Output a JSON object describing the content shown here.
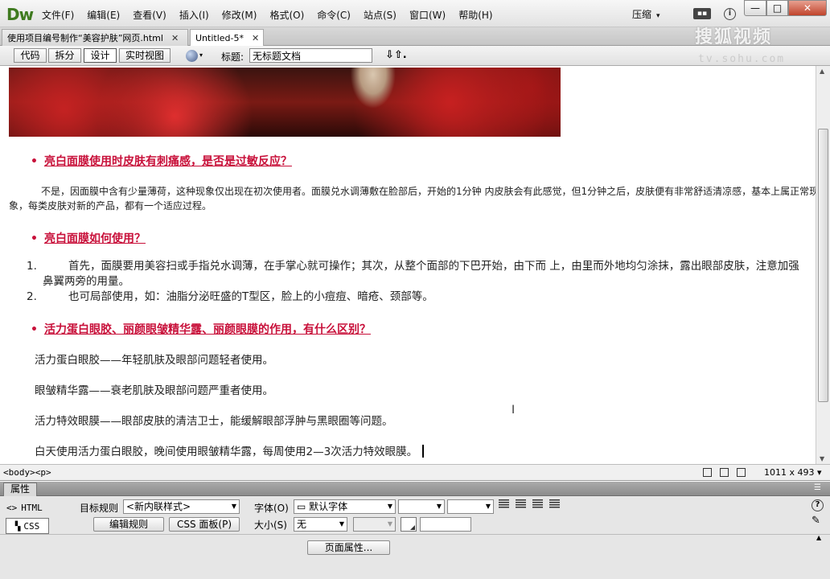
{
  "app": {
    "logo": "Dw",
    "workspace": "压缩"
  },
  "menu": [
    "文件(F)",
    "编辑(E)",
    "查看(V)",
    "插入(I)",
    "修改(M)",
    "格式(O)",
    "命令(C)",
    "站点(S)",
    "窗口(W)",
    "帮助(H)"
  ],
  "window_controls": {
    "minimize": "—",
    "maximize": "□",
    "close": "✕"
  },
  "tabs": [
    {
      "label": "使用项目编号制作“美容护肤”网页.html",
      "close": "✕"
    },
    {
      "label": "Untitled-5*",
      "close": "✕"
    }
  ],
  "watermark": {
    "logo": "搜狐视频",
    "url": "tv.sohu.com"
  },
  "doc_toolbar": {
    "views": [
      "代码",
      "拆分",
      "设计",
      "实时视图"
    ],
    "title_label": "标题:",
    "title_value": "无标题文档",
    "file_mgmt": "⇩⇧."
  },
  "content": {
    "q1": "亮白面膜使用时皮肤有刺痛感，是否是过敏反应？",
    "p1": "不是，因面膜中含有少量薄荷，这种现象仅出现在初次使用者。面膜兑水调薄敷在脸部后，开始的1分钟 内皮肤会有此感觉，但1分钟之后，皮肤便有非常舒适清凉感，基本上属正常现象，每类皮肤对新的产品，都有一个适应过程。",
    "q2": "亮白面膜如何使用？",
    "list": [
      {
        "num": "1.",
        "text": "首先，面膜要用美容扫或手指兑水调薄，在手掌心就可操作；其次，从整个面部的下巴开始，由下而 上，由里而外地均匀涂抹，露出眼部皮肤，注意加强鼻翼两旁的用量。"
      },
      {
        "num": "2.",
        "text": "也可局部使用，如：油脂分泌旺盛的T型区，脸上的小痘痘、暗疮、颈部等。"
      }
    ],
    "q3": "活力蛋白眼胶、丽颜眼皱精华露、丽颜眼膜的作用，有什么区别？",
    "lines": [
      "活力蛋白眼胶——年轻肌肤及眼部问题轻者使用。",
      "眼皱精华露——衰老肌肤及眼部问题严重者使用。",
      "活力特效眼膜——眼部皮肤的清洁卫士，能缓解眼部浮肿与黑眼圈等问题。",
      "白天使用活力蛋白眼胶，晚间使用眼皱精华露，每周使用2—3次活力特效眼膜。"
    ],
    "bullet": "•"
  },
  "status": {
    "tags": "<body><p>",
    "window_size": "1011 x 493 ▾"
  },
  "properties": {
    "panel_title": "属性",
    "html_label": "HTML",
    "css_label": "CSS",
    "target_rule_label": "目标规则",
    "target_rule_value": "<新内联样式>",
    "edit_rule": "编辑规则",
    "css_panel": "CSS 面板(P)",
    "font_label": "字体(O)",
    "font_value": "默认字体",
    "size_label": "大小(S)",
    "size_value": "无",
    "page_props": "页面属性..."
  }
}
